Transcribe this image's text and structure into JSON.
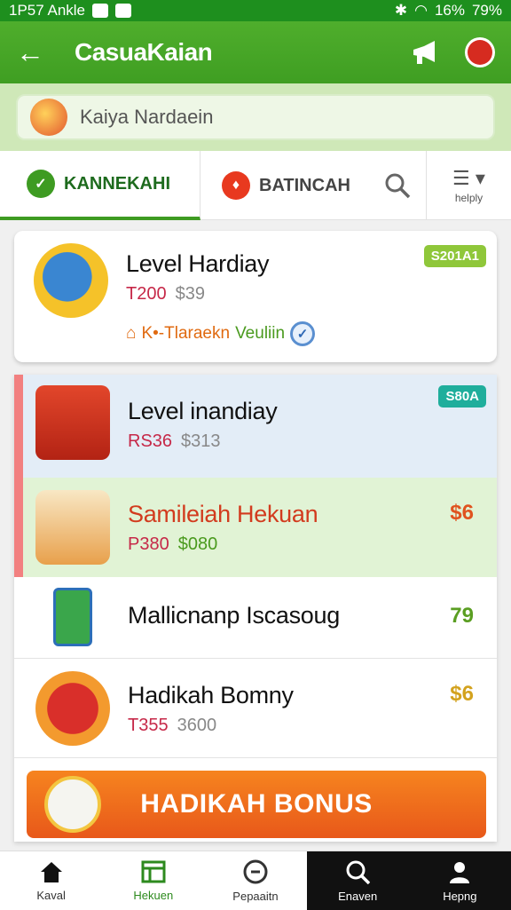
{
  "status_bar": {
    "left_text": "1P57 Ankle",
    "battery1": "16%",
    "battery2": "79%"
  },
  "app_bar": {
    "title": "CasuaKaian"
  },
  "search": {
    "value": "Kaiya Nardaein"
  },
  "tabs": [
    {
      "label": "KANNEKAHI",
      "icon": "check-badge-icon"
    },
    {
      "label": "BATINCAH",
      "icon": "fire-badge-icon"
    }
  ],
  "tab_menu": {
    "label": "helply"
  },
  "card_featured": {
    "name": "Level Hardiay",
    "price_old": "T200",
    "price_new": "$39",
    "badge": "S201A1",
    "sub_left": "K•-Tlaraekn",
    "sub_right": "Veuliin",
    "icon": "whale-icon"
  },
  "list_items": [
    {
      "name": "Level inandiay",
      "price_old": "RS36",
      "price_new": "$313",
      "badge": "S80A",
      "right": "",
      "icon": "treasure-chest-icon"
    },
    {
      "name": "Samileiah Hekuan",
      "price_old": "P380",
      "price_new": "$080",
      "badge": "",
      "right": "$6",
      "icon": "gift-box-icon"
    },
    {
      "name": "Mallicnanp Iscasoug",
      "price_old": "",
      "price_new": "",
      "badge": "",
      "right": "79",
      "icon": "green-device-icon"
    },
    {
      "name": "Hadikah Bomny",
      "price_old": "T355",
      "price_new": "3600",
      "badge": "",
      "right": "$6",
      "icon": "red-chest-icon"
    }
  ],
  "cta": {
    "label": "HADIKAH BONUS"
  },
  "bottom_nav": [
    {
      "label": "Kaval",
      "icon": "home-icon"
    },
    {
      "label": "Hekuen",
      "icon": "grid-icon"
    },
    {
      "label": "Pepaaitn",
      "icon": "compass-icon"
    },
    {
      "label": "Enaven",
      "icon": "search-icon"
    },
    {
      "label": "Hepng",
      "icon": "profile-icon"
    }
  ],
  "colors": {
    "primary_green": "#3f9e22",
    "cta_orange": "#f07a1e",
    "accent_pink": "#f28080"
  }
}
